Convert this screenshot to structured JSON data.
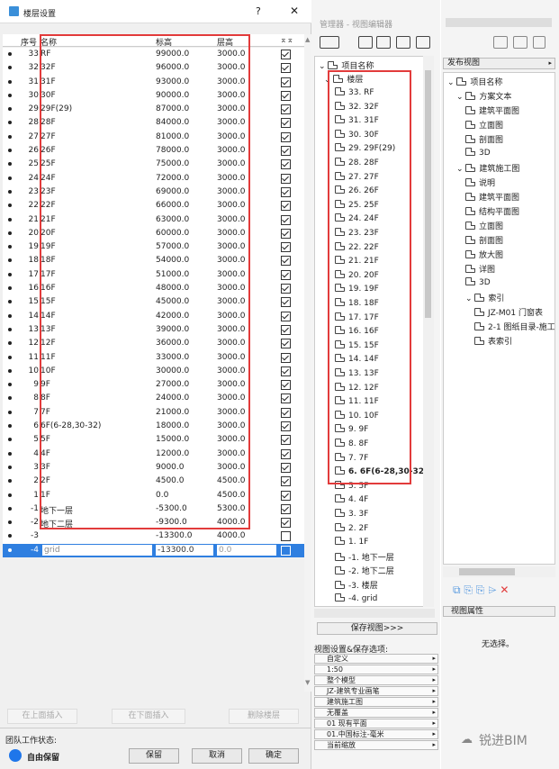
{
  "dialog": {
    "title": "楼层设置",
    "help": "?",
    "close": "✕"
  },
  "columns": {
    "index": "序号",
    "name": "名称",
    "elevation": "标高",
    "height": "层高",
    "show": "⌅⌅"
  },
  "stories": [
    {
      "n": "33",
      "name": "RF",
      "elev": "99000.0",
      "h": "3000.0",
      "on": true
    },
    {
      "n": "32",
      "name": "32F",
      "elev": "96000.0",
      "h": "3000.0",
      "on": true
    },
    {
      "n": "31",
      "name": "31F",
      "elev": "93000.0",
      "h": "3000.0",
      "on": true
    },
    {
      "n": "30",
      "name": "30F",
      "elev": "90000.0",
      "h": "3000.0",
      "on": true
    },
    {
      "n": "29",
      "name": "29F(29)",
      "elev": "87000.0",
      "h": "3000.0",
      "on": true
    },
    {
      "n": "28",
      "name": "28F",
      "elev": "84000.0",
      "h": "3000.0",
      "on": true
    },
    {
      "n": "27",
      "name": "27F",
      "elev": "81000.0",
      "h": "3000.0",
      "on": true
    },
    {
      "n": "26",
      "name": "26F",
      "elev": "78000.0",
      "h": "3000.0",
      "on": true
    },
    {
      "n": "25",
      "name": "25F",
      "elev": "75000.0",
      "h": "3000.0",
      "on": true
    },
    {
      "n": "24",
      "name": "24F",
      "elev": "72000.0",
      "h": "3000.0",
      "on": true
    },
    {
      "n": "23",
      "name": "23F",
      "elev": "69000.0",
      "h": "3000.0",
      "on": true
    },
    {
      "n": "22",
      "name": "22F",
      "elev": "66000.0",
      "h": "3000.0",
      "on": true
    },
    {
      "n": "21",
      "name": "21F",
      "elev": "63000.0",
      "h": "3000.0",
      "on": true
    },
    {
      "n": "20",
      "name": "20F",
      "elev": "60000.0",
      "h": "3000.0",
      "on": true
    },
    {
      "n": "19",
      "name": "19F",
      "elev": "57000.0",
      "h": "3000.0",
      "on": true
    },
    {
      "n": "18",
      "name": "18F",
      "elev": "54000.0",
      "h": "3000.0",
      "on": true
    },
    {
      "n": "17",
      "name": "17F",
      "elev": "51000.0",
      "h": "3000.0",
      "on": true
    },
    {
      "n": "16",
      "name": "16F",
      "elev": "48000.0",
      "h": "3000.0",
      "on": true
    },
    {
      "n": "15",
      "name": "15F",
      "elev": "45000.0",
      "h": "3000.0",
      "on": true
    },
    {
      "n": "14",
      "name": "14F",
      "elev": "42000.0",
      "h": "3000.0",
      "on": true
    },
    {
      "n": "13",
      "name": "13F",
      "elev": "39000.0",
      "h": "3000.0",
      "on": true
    },
    {
      "n": "12",
      "name": "12F",
      "elev": "36000.0",
      "h": "3000.0",
      "on": true
    },
    {
      "n": "11",
      "name": "11F",
      "elev": "33000.0",
      "h": "3000.0",
      "on": true
    },
    {
      "n": "10",
      "name": "10F",
      "elev": "30000.0",
      "h": "3000.0",
      "on": true
    },
    {
      "n": "9",
      "name": "9F",
      "elev": "27000.0",
      "h": "3000.0",
      "on": true
    },
    {
      "n": "8",
      "name": "8F",
      "elev": "24000.0",
      "h": "3000.0",
      "on": true
    },
    {
      "n": "7",
      "name": "7F",
      "elev": "21000.0",
      "h": "3000.0",
      "on": true
    },
    {
      "n": "6",
      "name": "6F(6-28,30-32)",
      "elev": "18000.0",
      "h": "3000.0",
      "on": true
    },
    {
      "n": "5",
      "name": "5F",
      "elev": "15000.0",
      "h": "3000.0",
      "on": true
    },
    {
      "n": "4",
      "name": "4F",
      "elev": "12000.0",
      "h": "3000.0",
      "on": true
    },
    {
      "n": "3",
      "name": "3F",
      "elev": "9000.0",
      "h": "3000.0",
      "on": true
    },
    {
      "n": "2",
      "name": "2F",
      "elev": "4500.0",
      "h": "4500.0",
      "on": true
    },
    {
      "n": "1",
      "name": "1F",
      "elev": "0.0",
      "h": "4500.0",
      "on": true
    },
    {
      "n": "-1",
      "name": "地下一层",
      "elev": "-5300.0",
      "h": "5300.0",
      "on": true
    },
    {
      "n": "-2",
      "name": "地下二层",
      "elev": "-9300.0",
      "h": "4000.0",
      "on": true
    },
    {
      "n": "-3",
      "name": "",
      "elev": "-13300.0",
      "h": "4000.0",
      "on": false
    },
    {
      "n": "-4",
      "name": "grid",
      "elev": "-13300.0",
      "h": "0.0",
      "on": false,
      "selected": true
    }
  ],
  "buttons": {
    "insert_above": "在上面插入",
    "insert_below": "在下面插入",
    "delete": "删除楼层",
    "keep": "保留",
    "cancel": "取消",
    "ok": "确定"
  },
  "team": {
    "label": "团队工作状态:",
    "status": "自由保留"
  },
  "navigator": {
    "title": "管理器 - 视图编辑器",
    "root": "项目名称",
    "stories_folder": "楼层",
    "items": [
      "33. RF",
      "32. 32F",
      "31. 31F",
      "30. 30F",
      "29. 29F(29)",
      "28. 28F",
      "27. 27F",
      "26. 26F",
      "25. 25F",
      "24. 24F",
      "23. 23F",
      "22. 22F",
      "21. 21F",
      "20. 20F",
      "19. 19F",
      "18. 18F",
      "17. 17F",
      "16. 16F",
      "15. 15F",
      "14. 14F",
      "13. 13F",
      "12. 12F",
      "11. 11F",
      "10. 10F",
      "9. 9F",
      "8. 8F",
      "7. 7F",
      "6. 6F(6-28,30-32)",
      "5. 5F",
      "4. 4F",
      "3. 3F",
      "2. 2F",
      "1. 1F",
      "-1. 地下一层",
      "-2. 地下二层",
      "-3. 楼层",
      "-4. grid"
    ],
    "save_view": "保存视图>>>",
    "options_label": "视图设置&保存选项:",
    "options": [
      "自定义",
      "1:50",
      "整个模型",
      "JZ-建筑专业画笔",
      "建筑施工图",
      "无覆盖",
      "01 现有平面",
      "01.中国标注-毫米",
      "当前缩放"
    ]
  },
  "publisher": {
    "set": "发布视图",
    "tree": [
      {
        "label": "项目名称",
        "level": 0
      },
      {
        "label": "方案文本",
        "level": 1
      },
      {
        "label": "建筑平面图",
        "level": 2
      },
      {
        "label": "立面图",
        "level": 2
      },
      {
        "label": "剖面图",
        "level": 2
      },
      {
        "label": "3D",
        "level": 2
      },
      {
        "label": "建筑施工图",
        "level": 1
      },
      {
        "label": "说明",
        "level": 2
      },
      {
        "label": "建筑平面图",
        "level": 2
      },
      {
        "label": "结构平面图",
        "level": 2
      },
      {
        "label": "立面图",
        "level": 2
      },
      {
        "label": "剖面图",
        "level": 2
      },
      {
        "label": "放大图",
        "level": 2
      },
      {
        "label": "详图",
        "level": 2
      },
      {
        "label": "3D",
        "level": 2
      },
      {
        "label": "索引",
        "level": 2
      },
      {
        "label": "JZ-M01 门窗表",
        "level": 3
      },
      {
        "label": "2-1 图纸目录-施工图",
        "level": 3
      },
      {
        "label": "表索引",
        "level": 3
      }
    ],
    "properties": "视图属性",
    "none_selected": "无选择。"
  },
  "watermark": "锐进BIM",
  "colors": {
    "selection": "#2f7fe0",
    "highlight": "#e23b3b"
  }
}
